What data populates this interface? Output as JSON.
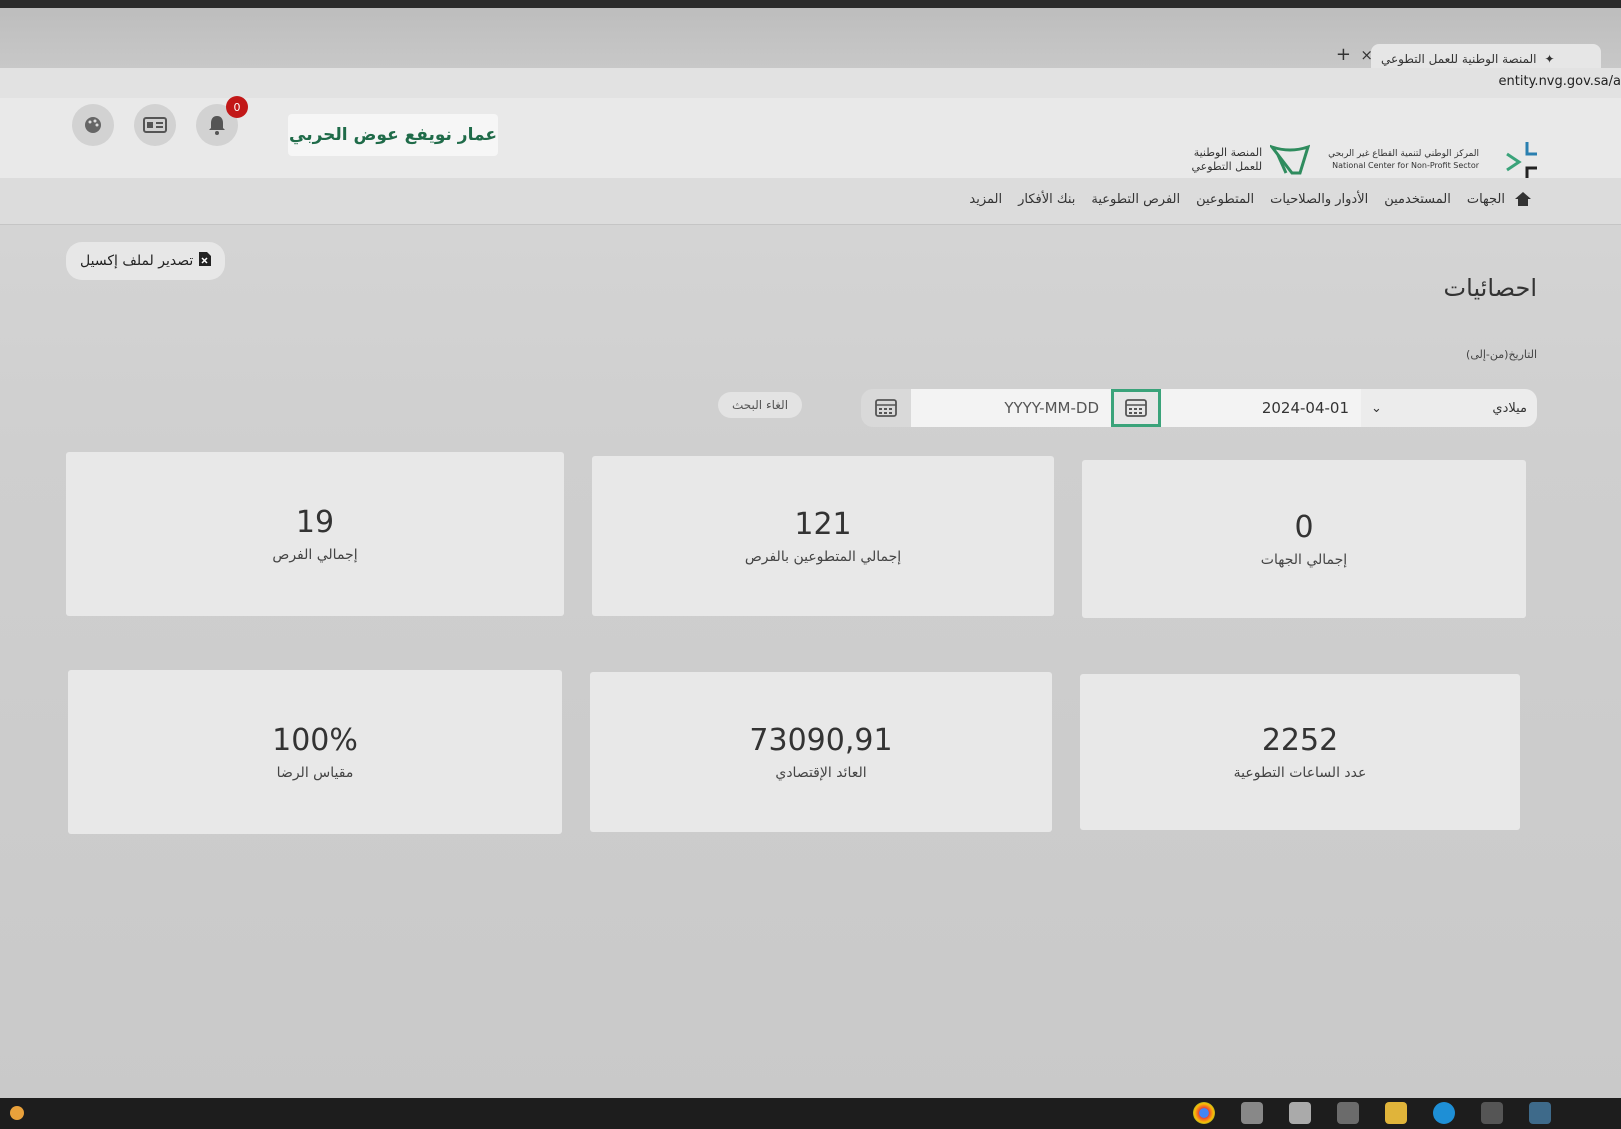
{
  "browser": {
    "tab_title": "المنصة الوطنية للعمل التطوعي",
    "new_tab": "+",
    "close": "×",
    "url": "entity.nvg.gov.sa/a"
  },
  "header": {
    "user_name": "عمار نويفع عوض الحربي",
    "notification_count": "0",
    "logo_ncnp_ar": "المركز الوطني لتنمية القطاع غير الربحي",
    "logo_ncnp_en": "National Center for Non-Profit Sector",
    "logo_platform_ar_1": "المنصة الوطنية",
    "logo_platform_ar_2": "للعمل التطوعي"
  },
  "nav": {
    "items": [
      {
        "label": "الجهات"
      },
      {
        "label": "المستخدمين"
      },
      {
        "label": "الأدوار والصلاحيات"
      },
      {
        "label": "المتطوعين"
      },
      {
        "label": "الفرص التطوعية"
      },
      {
        "label": "بنك الأفكار"
      },
      {
        "label": "المزيد"
      }
    ]
  },
  "page": {
    "title": "احصائيات",
    "export_label": "تصدير لملف إكسيل",
    "date_range_label": "التاريخ(من-إلى)",
    "calendar_type": "ميلادي",
    "date_from": "2024-04-01",
    "date_to_placeholder": "YYYY-MM-DD",
    "cancel_search": "الغاء البحث"
  },
  "stats": {
    "row1": [
      {
        "value": "0",
        "label": "إجمالي الجهات"
      },
      {
        "value": "121",
        "label": "إجمالي المتطوعين بالفرص"
      },
      {
        "value": "19",
        "label": "إجمالي الفرص"
      }
    ],
    "row2": [
      {
        "value": "2252",
        "label": "عدد الساعات التطوعية"
      },
      {
        "value": "73090,91",
        "label": "العائد الإقتصادي"
      },
      {
        "value": "100%",
        "label": "مقياس الرضا"
      }
    ]
  },
  "colors": {
    "brand_green": "#1f6b49",
    "active_border": "#3aa37a",
    "badge_red": "#c21818"
  }
}
